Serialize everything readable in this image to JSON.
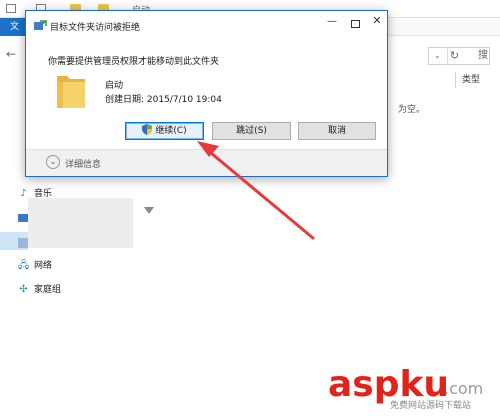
{
  "explorer": {
    "window_title": "启动",
    "file_tab": "文",
    "columns": {
      "size": "类型"
    },
    "empty_message": "为空。",
    "search_fragment": "搜",
    "sidebar": [
      {
        "label": "音乐",
        "icon": "music-icon"
      },
      {
        "label": "网络",
        "icon": "network-icon"
      },
      {
        "label": "家庭组",
        "icon": "homegroup-icon"
      }
    ]
  },
  "dialog": {
    "title": "目标文件夹访问被拒绝",
    "message": "你需要提供管理员权限才能移动到此文件夹",
    "folder_name": "启动",
    "folder_date": "创建日期: 2015/7/10 19:04",
    "buttons": {
      "continue": "继续(C)",
      "skip": "跳过(S)",
      "cancel": "取消"
    },
    "details": "详细信息",
    "close_glyph": "✕",
    "minimize_glyph": "—"
  },
  "watermark": {
    "brand": "aspku",
    "suffix": ".com",
    "sub": "免费网站源码下载站"
  },
  "colors": {
    "accent": "#0078d7",
    "arrow": "#e53b3b",
    "folder": "#f0c54b",
    "watermark_red": "#e2231a"
  }
}
